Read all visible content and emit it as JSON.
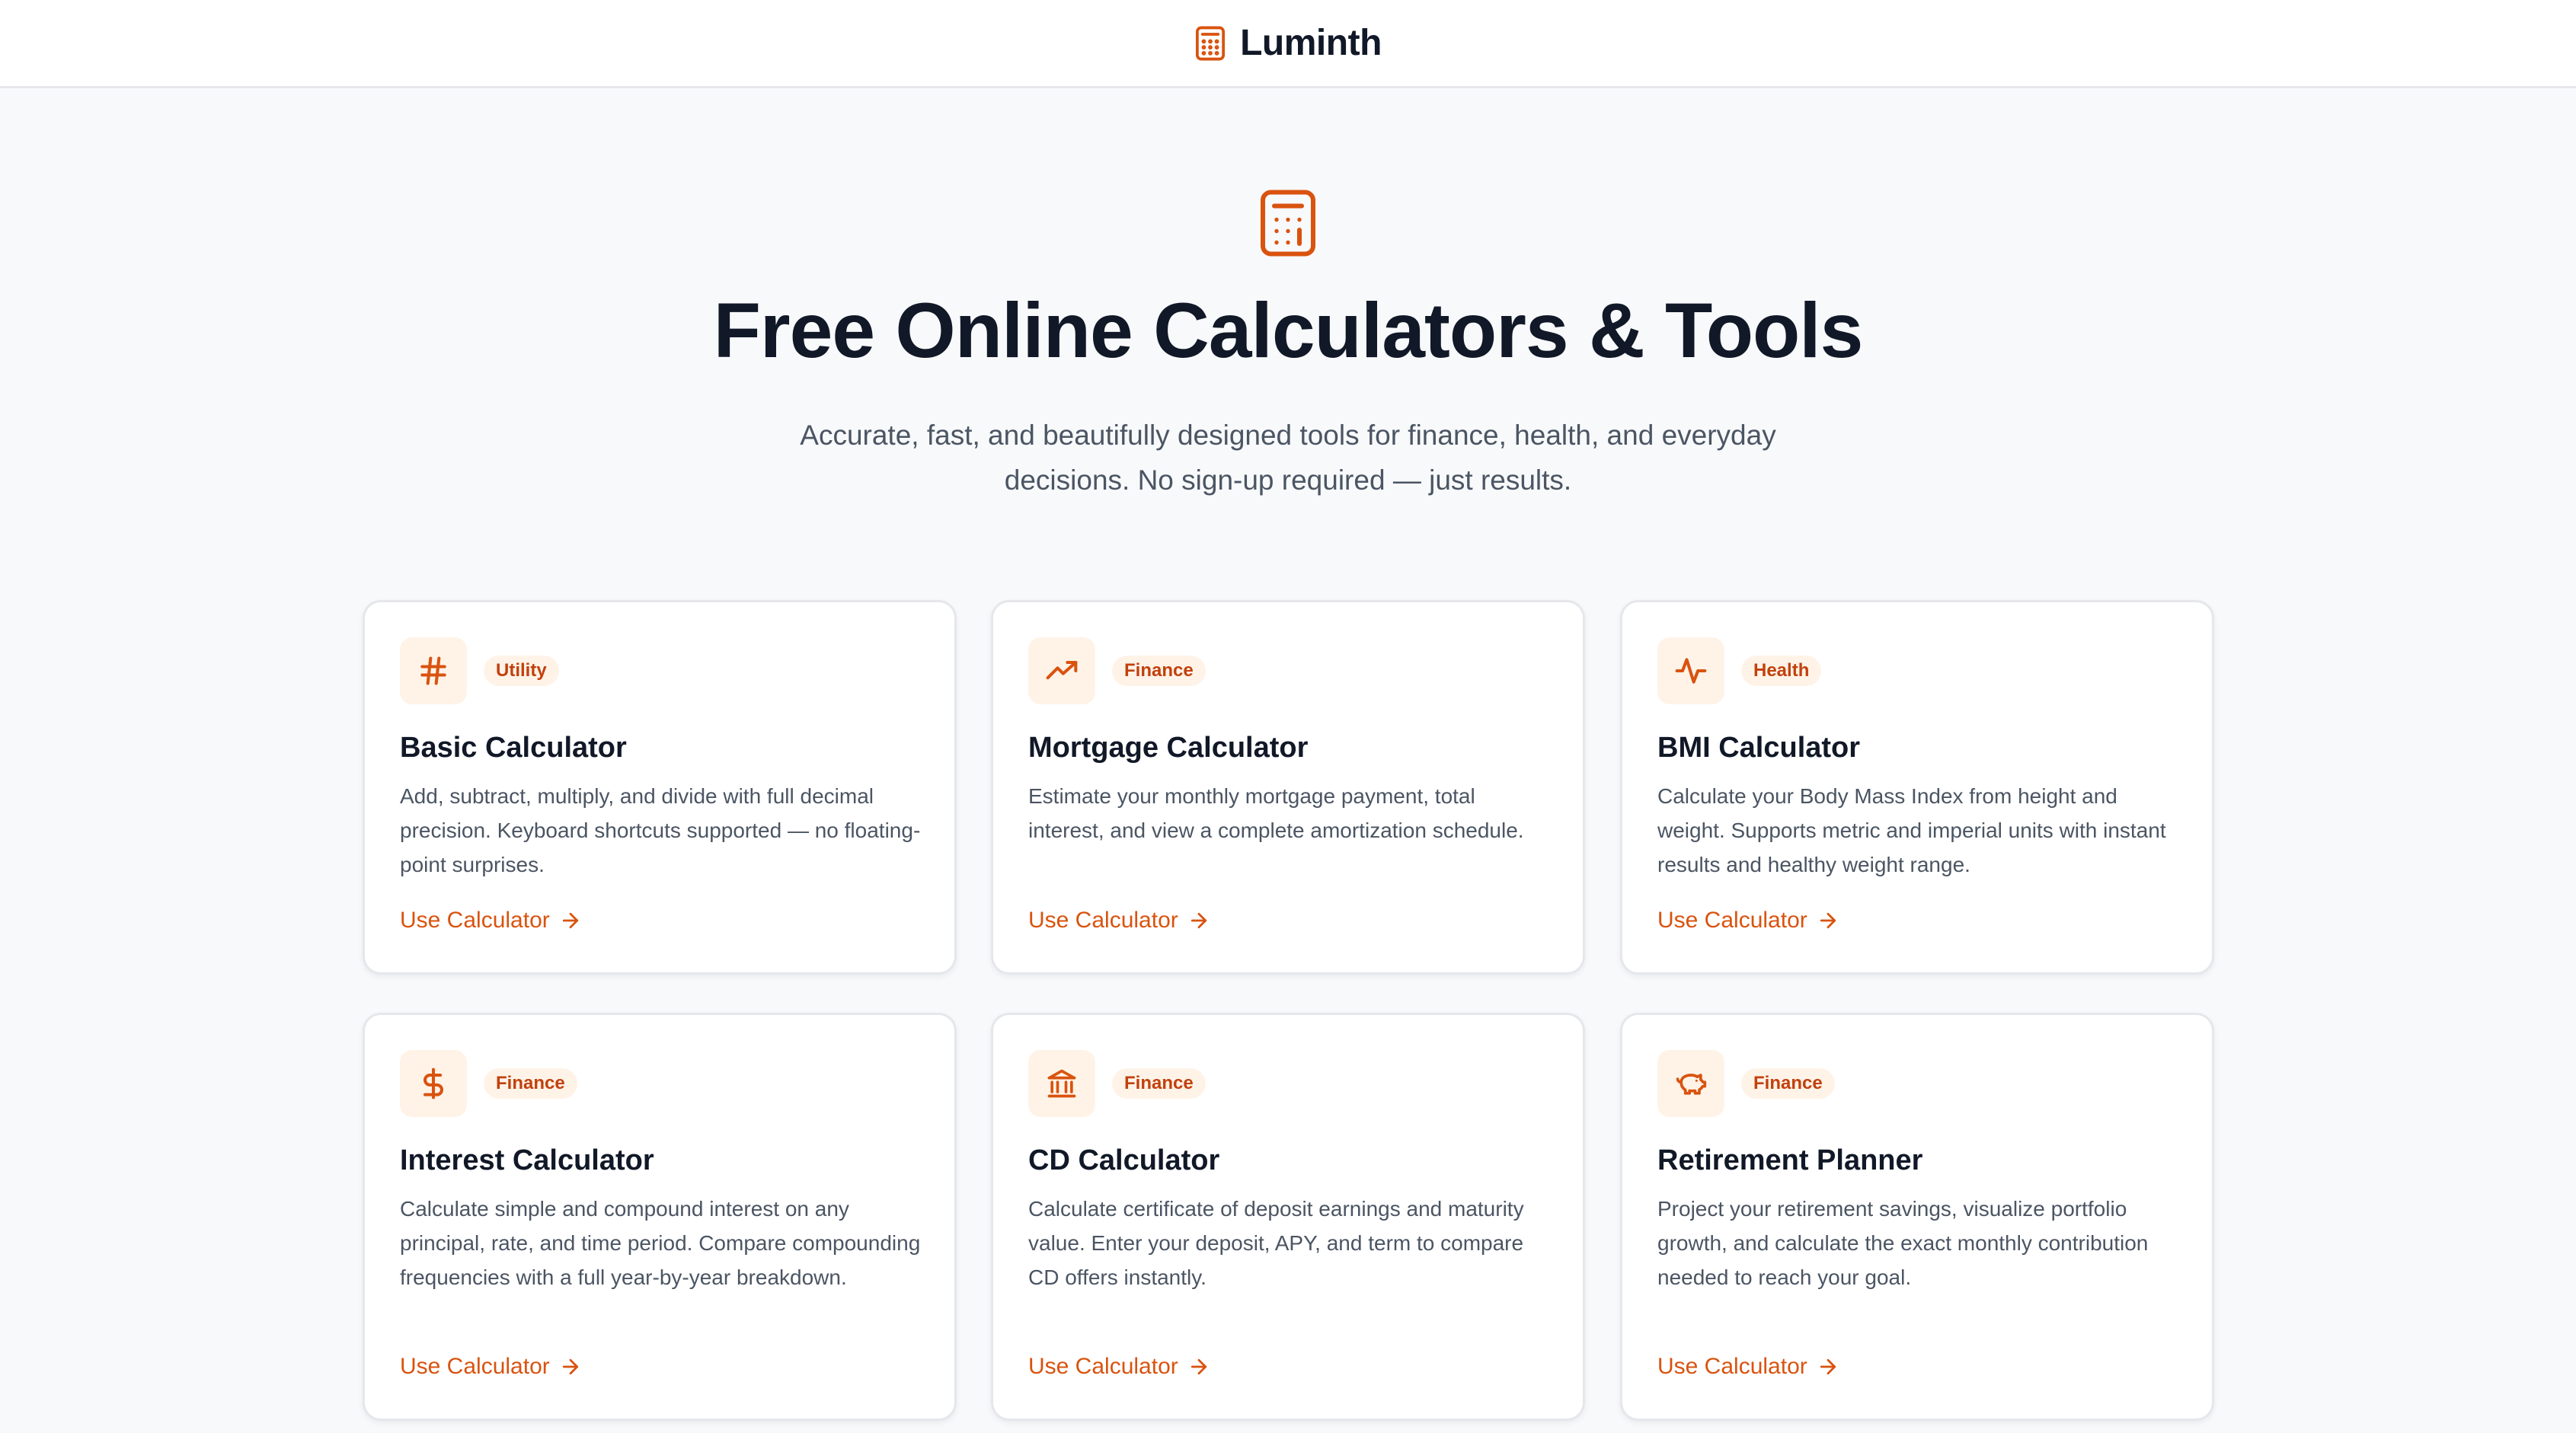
{
  "header": {
    "brand": "Luminth",
    "brand_icon": "calculator-icon"
  },
  "hero": {
    "icon": "calculator-icon",
    "title": "Free Online Calculators & Tools",
    "subtitle": "Accurate, fast, and beautifully designed tools for finance, health, and everyday decisions. No sign-up required — just results."
  },
  "accent_color": "#d9530f",
  "cards": [
    {
      "icon": "hash-icon",
      "tag": "Utility",
      "title": "Basic Calculator",
      "desc": "Add, subtract, multiply, and divide with full decimal precision. Keyboard shortcuts supported — no floating-point surprises.",
      "link": "Use Calculator"
    },
    {
      "icon": "trending-up-icon",
      "tag": "Finance",
      "title": "Mortgage Calculator",
      "desc": "Estimate your monthly mortgage payment, total interest, and view a complete amortization schedule.",
      "link": "Use Calculator"
    },
    {
      "icon": "activity-icon",
      "tag": "Health",
      "title": "BMI Calculator",
      "desc": "Calculate your Body Mass Index from height and weight. Supports metric and imperial units with instant results and healthy weight range.",
      "link": "Use Calculator"
    },
    {
      "icon": "dollar-icon",
      "tag": "Finance",
      "title": "Interest Calculator",
      "desc": "Calculate simple and compound interest on any principal, rate, and time period. Compare compounding frequencies with a full year-by-year breakdown.",
      "link": "Use Calculator"
    },
    {
      "icon": "bank-icon",
      "tag": "Finance",
      "title": "CD Calculator",
      "desc": "Calculate certificate of deposit earnings and maturity value. Enter your deposit, APY, and term to compare CD offers instantly.",
      "link": "Use Calculator"
    },
    {
      "icon": "piggy-bank-icon",
      "tag": "Finance",
      "title": "Retirement Planner",
      "desc": "Project your retirement savings, visualize portfolio growth, and calculate the exact monthly contribution needed to reach your goal.",
      "link": "Use Calculator"
    }
  ]
}
